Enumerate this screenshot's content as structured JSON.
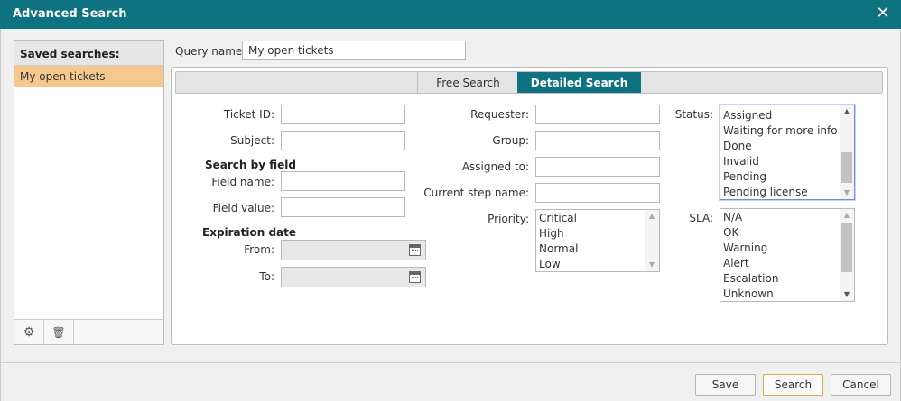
{
  "window": {
    "title": "Advanced Search",
    "close_symbol": "✕"
  },
  "saved": {
    "header": "Saved searches:",
    "items": [
      "My open tickets"
    ],
    "footer": {
      "settings_symbol": "⚙",
      "delete_symbol": "🗑"
    }
  },
  "query": {
    "label": "Query name:",
    "value": "My open tickets"
  },
  "tabs": {
    "free": "Free Search",
    "detailed": "Detailed Search"
  },
  "left": {
    "ticket_id": "Ticket ID:",
    "subject": "Subject:",
    "search_by_field": "Search by field",
    "field_name": "Field name:",
    "field_value": "Field value:",
    "expiration_date": "Expiration date",
    "from": "From:",
    "to": "To:"
  },
  "middle": {
    "requester": "Requester:",
    "group": "Group:",
    "assigned_to": "Assigned to:",
    "current_step": "Current step name:",
    "priority": "Priority:",
    "priority_options": [
      "Critical",
      "High",
      "Normal",
      "Low"
    ]
  },
  "right": {
    "status": "Status:",
    "status_options": [
      "Assigned",
      "Waiting for more info",
      "Done",
      "Invalid",
      "Pending",
      "Pending license"
    ],
    "sla": "SLA:",
    "sla_options": [
      "N/A",
      "OK",
      "Warning",
      "Alert",
      "Escalation",
      "Unknown"
    ]
  },
  "buttons": {
    "save": "Save",
    "search": "Search",
    "cancel": "Cancel"
  },
  "colors": {
    "accent": "#0f7280",
    "selected_item": "#f5c98e",
    "primary_border": "#e0a64a"
  }
}
